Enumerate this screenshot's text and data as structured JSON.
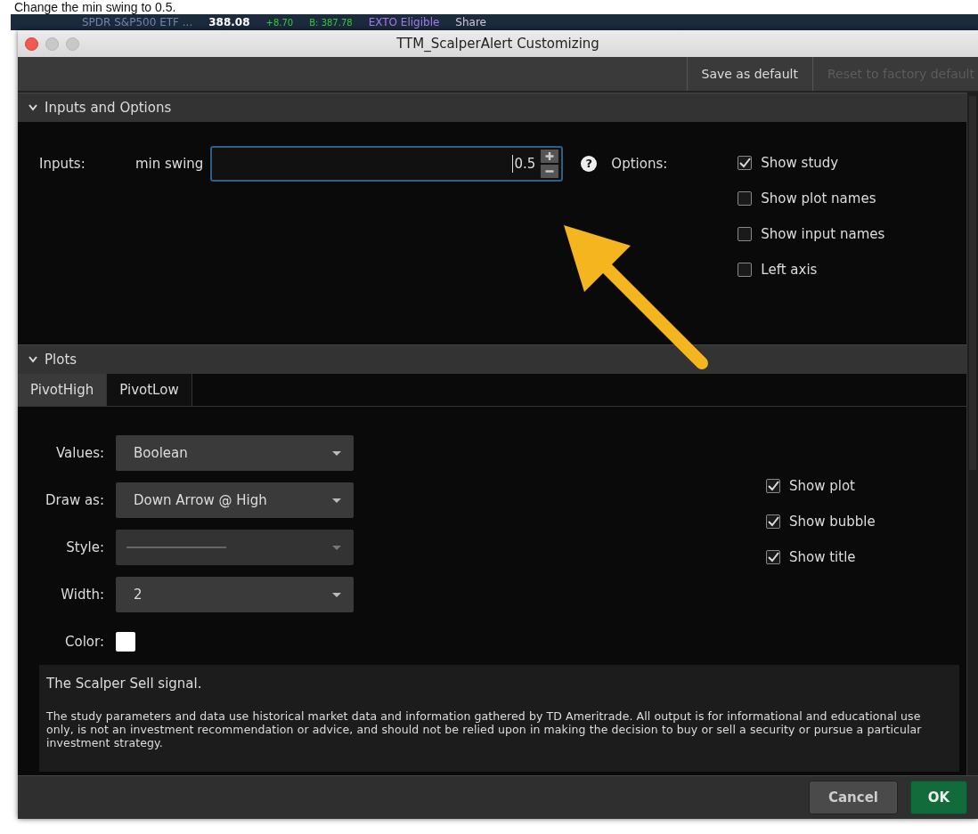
{
  "caption": "Change the min swing to 0.5.",
  "app_toolbar": {
    "symbol": "SPDR S&P500 ETF ...",
    "price": "388.08",
    "change": "+8.70",
    "bid": "B: 387.78",
    "badge": "EXTO Eligible",
    "share": "Share"
  },
  "dialog": {
    "title": "TTM_ScalperAlert Customizing",
    "toolbar": [
      {
        "label": "Save as default",
        "disabled": false
      },
      {
        "label": "Reset to factory default",
        "disabled": true
      }
    ],
    "inputs_section": {
      "title": "Inputs and Options",
      "expanded": true,
      "inputs_label": "Inputs:",
      "inputs": [
        {
          "label": "min swing",
          "value": "0.5",
          "help": "?"
        }
      ],
      "options_label": "Options:",
      "options": [
        {
          "label": "Show study",
          "checked": true
        },
        {
          "label": "Show plot names",
          "checked": false
        },
        {
          "label": "Show input names",
          "checked": false
        },
        {
          "label": "Left axis",
          "checked": false
        }
      ]
    },
    "plots_section": {
      "title": "Plots",
      "expanded": true,
      "tabs": [
        {
          "label": "PivotHigh",
          "selected": true
        },
        {
          "label": "PivotLow",
          "selected": false
        }
      ],
      "fields": [
        {
          "label": "Values:",
          "kind": "dropdown",
          "value": "Boolean",
          "disabled": false
        },
        {
          "label": "Draw as:",
          "kind": "dropdown",
          "value": "Down Arrow @ High",
          "disabled": false
        },
        {
          "label": "Style:",
          "kind": "line",
          "disabled": true
        },
        {
          "label": "Width:",
          "kind": "dropdown",
          "value": "2",
          "disabled": false
        },
        {
          "label": "Color:",
          "kind": "swatch",
          "color": "#ffffff"
        }
      ],
      "options": [
        {
          "label": "Show plot",
          "checked": true
        },
        {
          "label": "Show bubble",
          "checked": true
        },
        {
          "label": "Show title",
          "checked": true
        }
      ]
    },
    "description": {
      "title": "The Scalper Sell signal.",
      "text": "The study parameters and data use historical market data and information gathered by TD Ameritrade. All output is for informational and educational use only, is not an investment recommendation or advice, and should not be relied upon in making the decision to buy or sell a security or pursue a particular investment strategy."
    },
    "buttons": [
      {
        "label": "Cancel",
        "kind": "secondary"
      },
      {
        "label": "OK",
        "kind": "primary"
      }
    ]
  }
}
